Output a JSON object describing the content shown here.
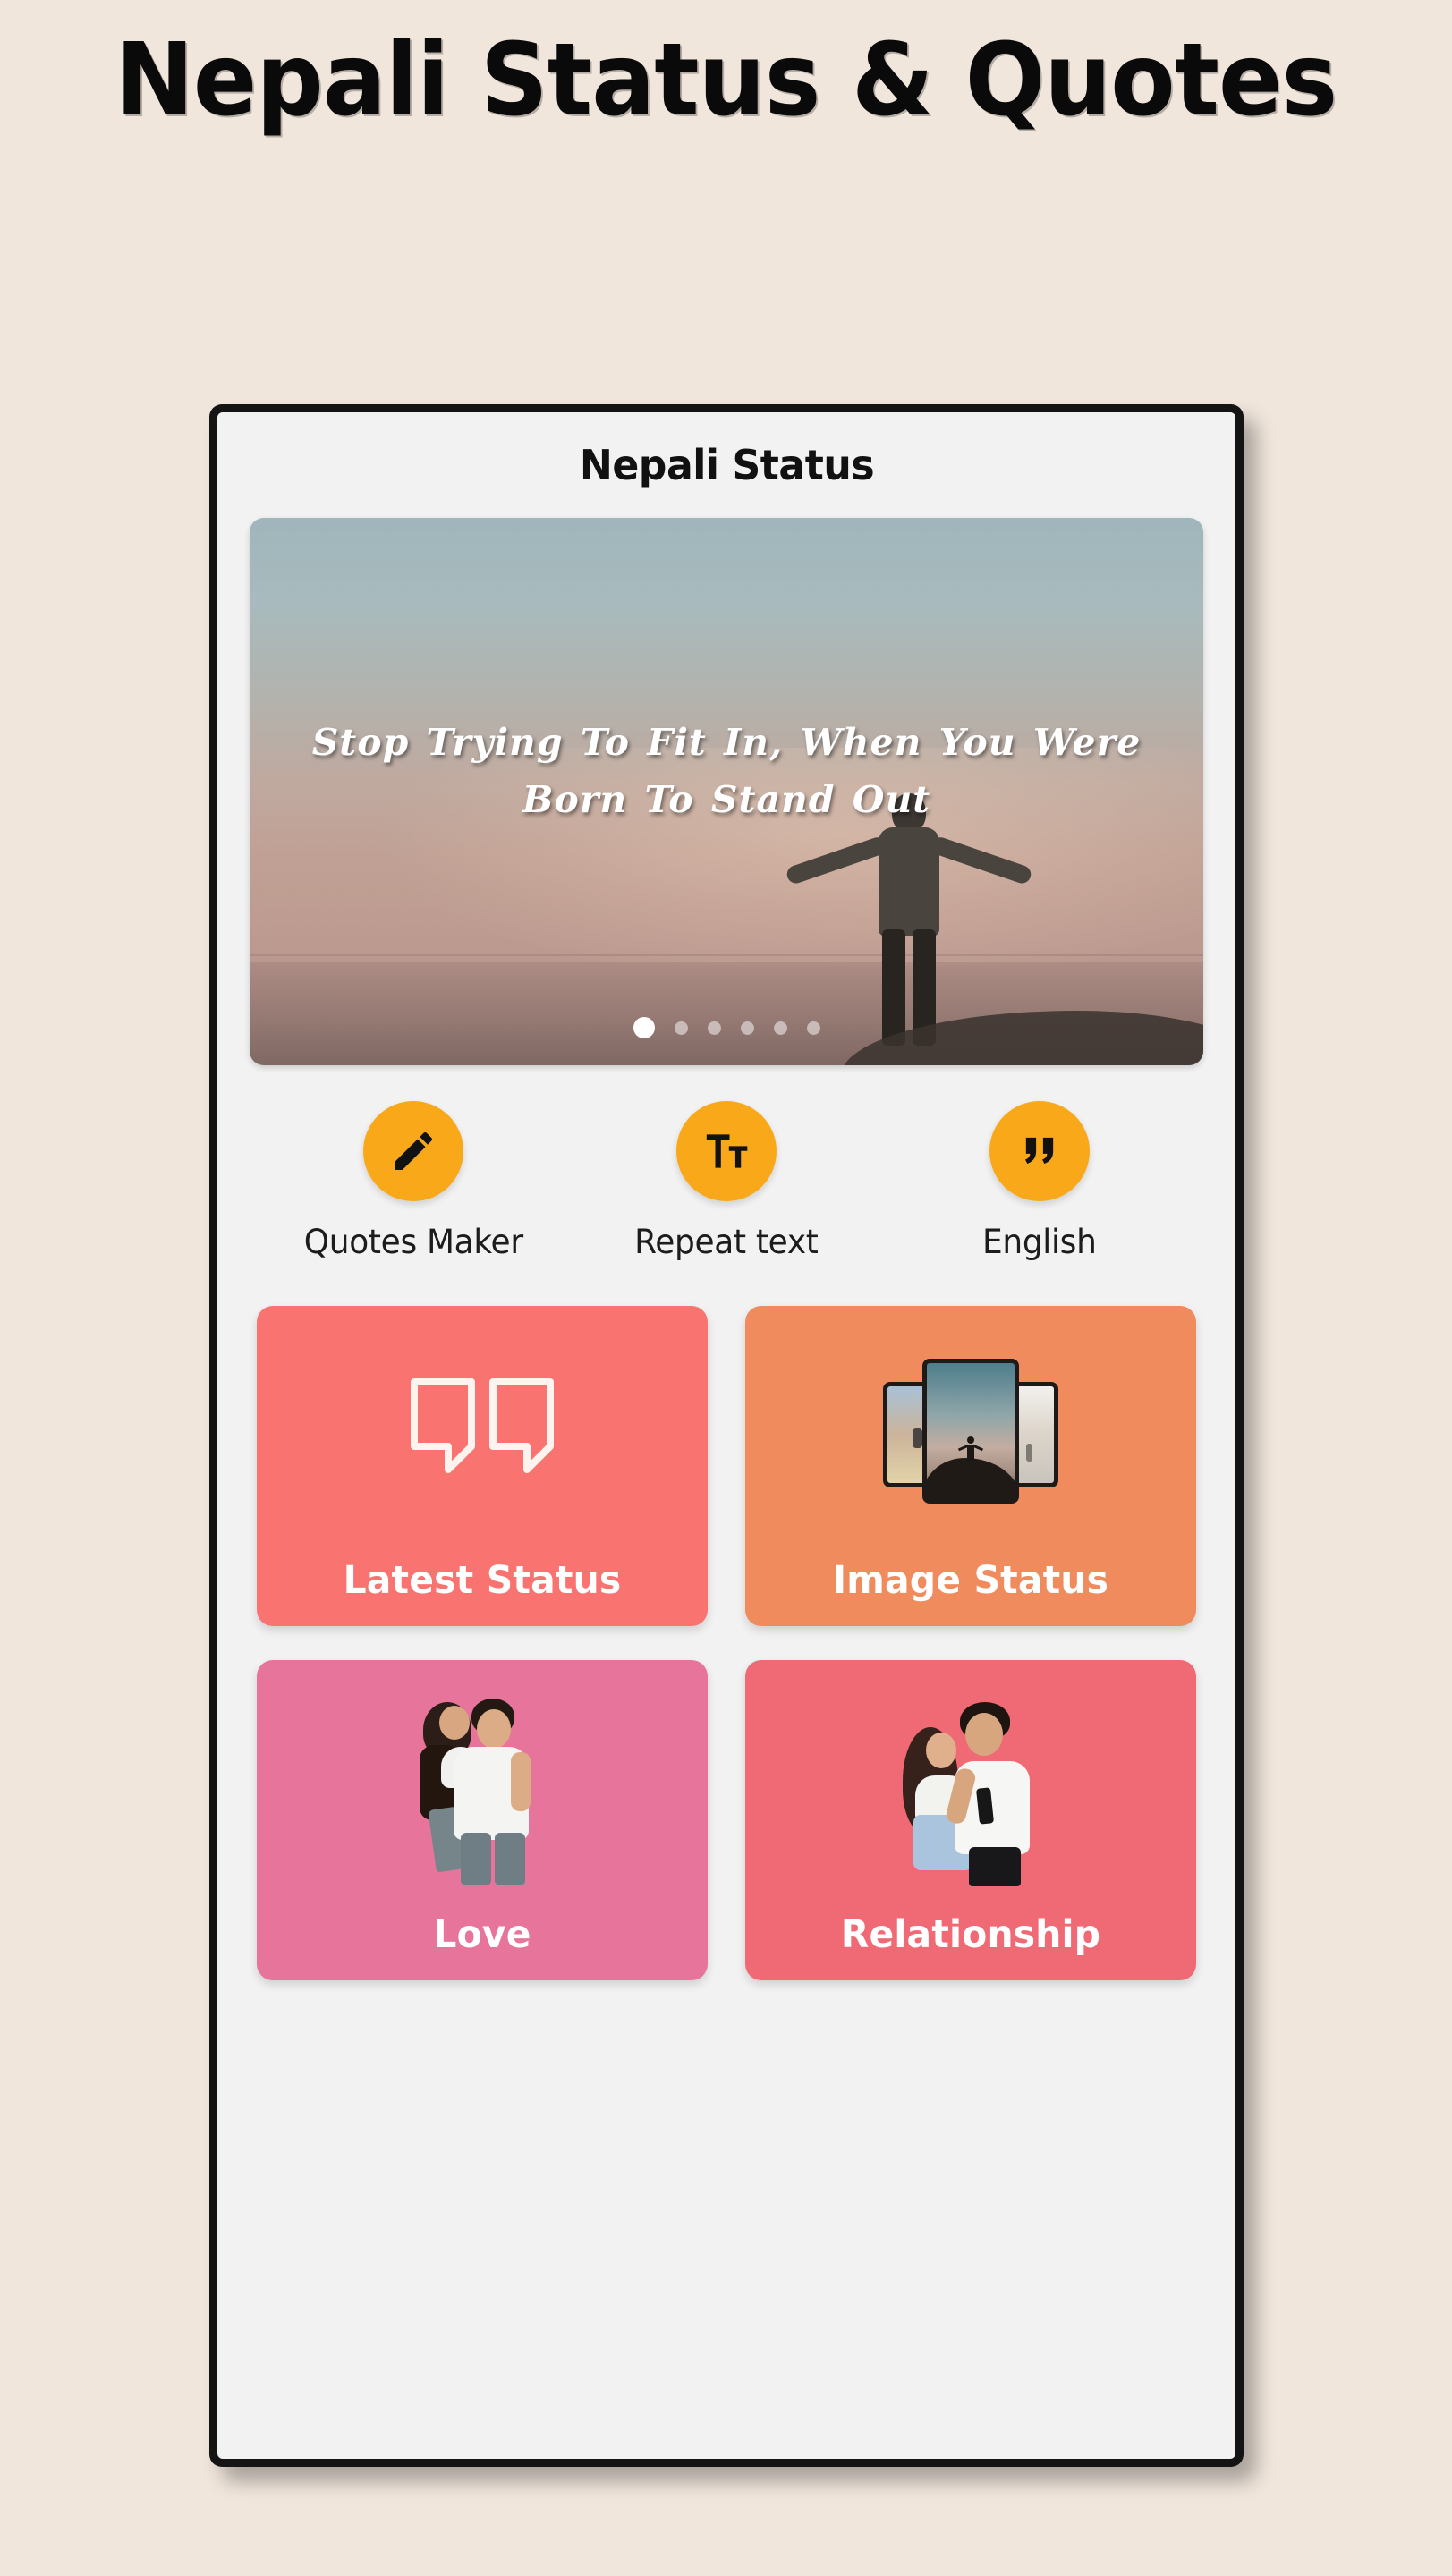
{
  "promo": {
    "title": "Nepali Status & Quotes"
  },
  "app": {
    "title": "Nepali Status"
  },
  "banner": {
    "quote": "Stop Trying To Fit In, When You Were Born To Stand Out",
    "dots_total": 6,
    "active_dot": 1
  },
  "quick_actions": [
    {
      "label": "Quotes Maker",
      "icon": "pencil-icon"
    },
    {
      "label": "Repeat text",
      "icon": "format-size-icon"
    },
    {
      "label": "English",
      "icon": "quote-marks-icon"
    }
  ],
  "cards": [
    {
      "label": "Latest Status",
      "color": "#F97370",
      "art": "quote-bubbles-icon"
    },
    {
      "label": "Image Status",
      "color": "#EF8B5D",
      "art": "stacked-photos-icon"
    },
    {
      "label": "Love",
      "color": "#E7749B",
      "art": "couple-piggyback-photo"
    },
    {
      "label": "Relationship",
      "color": "#F06A75",
      "art": "couple-hug-photo"
    }
  ],
  "colors": {
    "page_background": "#F0E6DC",
    "screen_background": "#F2F2F2",
    "accent_orange": "#F9A81A",
    "phone_frame": "#141414",
    "label_white": "#FFFFFF"
  }
}
